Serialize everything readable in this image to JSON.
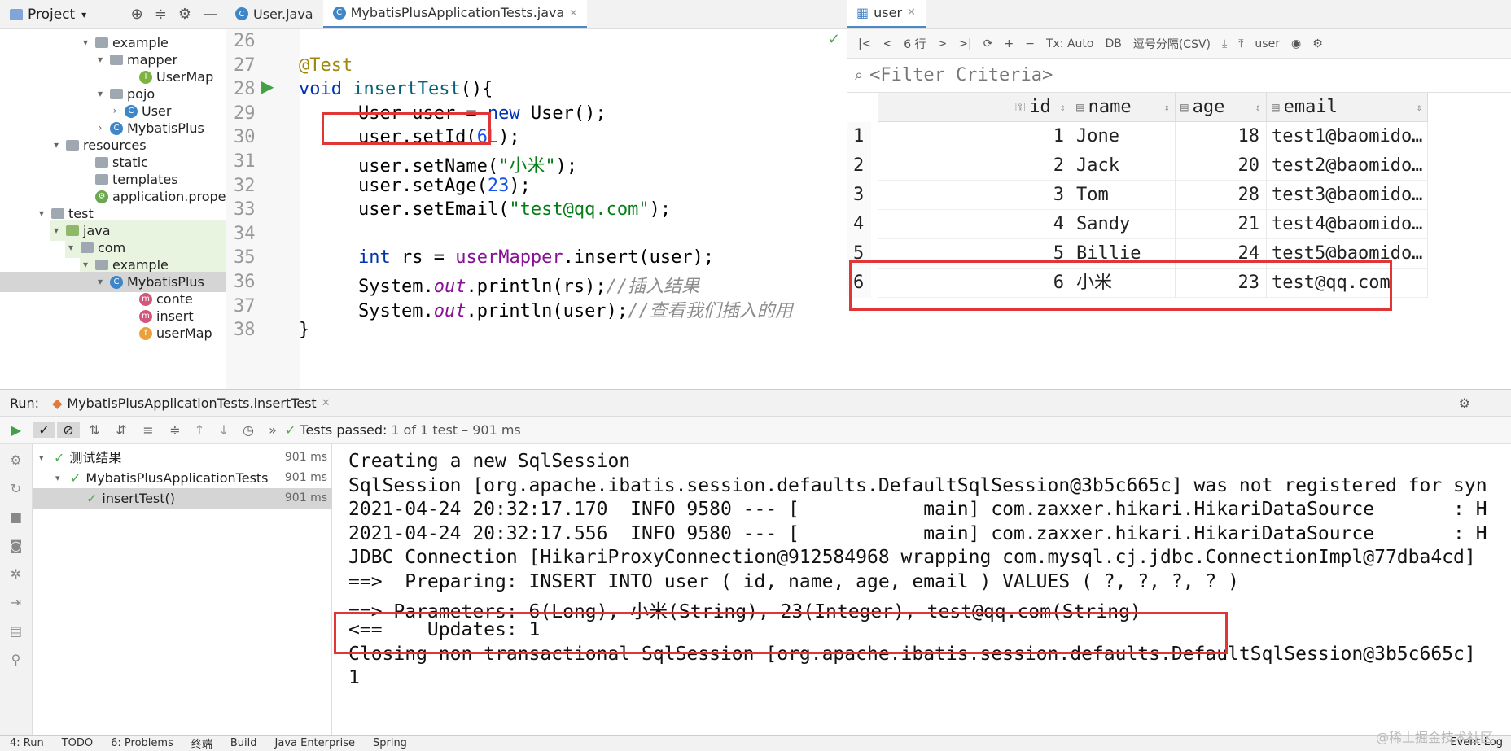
{
  "project": {
    "title": "Project",
    "tree": [
      {
        "label": "example",
        "level": 6,
        "type": "folder",
        "arrow": "▾"
      },
      {
        "label": "mapper",
        "level": 7,
        "type": "folder",
        "arrow": "▾"
      },
      {
        "label": "UserMap",
        "level": 9,
        "type": "interface",
        "arrow": ""
      },
      {
        "label": "pojo",
        "level": 7,
        "type": "folder",
        "arrow": "▾"
      },
      {
        "label": "User",
        "level": 8,
        "type": "class",
        "arrow": "›"
      },
      {
        "label": "MybatisPlus",
        "level": 7,
        "type": "class",
        "arrow": "›"
      },
      {
        "label": "resources",
        "level": 4,
        "type": "folder",
        "arrow": "▾"
      },
      {
        "label": "static",
        "level": 6,
        "type": "folder",
        "arrow": ""
      },
      {
        "label": "templates",
        "level": 6,
        "type": "folder",
        "arrow": ""
      },
      {
        "label": "application.prope",
        "level": 6,
        "type": "props",
        "arrow": ""
      },
      {
        "label": "test",
        "level": 3,
        "type": "folder",
        "arrow": "▾"
      },
      {
        "label": "java",
        "level": 4,
        "type": "srcfolder",
        "arrow": "▾"
      },
      {
        "label": "com",
        "level": 5,
        "type": "folder",
        "arrow": "▾"
      },
      {
        "label": "example",
        "level": 6,
        "type": "folder",
        "arrow": "▾"
      },
      {
        "label": "MybatisPlus",
        "level": 7,
        "type": "class",
        "arrow": "▾"
      },
      {
        "label": "conte",
        "level": 9,
        "type": "method",
        "arrow": ""
      },
      {
        "label": "insert",
        "level": 9,
        "type": "method",
        "arrow": ""
      },
      {
        "label": "userMap",
        "level": 9,
        "type": "field",
        "arrow": ""
      }
    ]
  },
  "editor": {
    "tabs": [
      {
        "label": "User.java",
        "active": false
      },
      {
        "label": "MybatisPlusApplicationTests.java",
        "active": true
      }
    ],
    "lines": [
      {
        "n": "26",
        "html": ""
      },
      {
        "n": "27",
        "html": "<span class='ann'>@Test</span>"
      },
      {
        "n": "28",
        "html": "<span class='kw'>void</span> <span class='fn'>insertTest</span>(){"
      },
      {
        "n": "29",
        "html": "    User user = <span class='kw'>new</span> User();"
      },
      {
        "n": "30",
        "html": "    user.setId(<span class='num'>6L</span>);"
      },
      {
        "n": "31",
        "html": "    user.setName(<span class='str'>\"小米\"</span>);"
      },
      {
        "n": "32",
        "html": "    user.setAge(<span class='num'>23</span>);"
      },
      {
        "n": "33",
        "html": "    user.setEmail(<span class='str'>\"test@qq.com\"</span>);"
      },
      {
        "n": "34",
        "html": ""
      },
      {
        "n": "35",
        "html": "    <span class='kw'>int</span> rs = <span class='fld'>userMapper</span>.insert(user);"
      },
      {
        "n": "36",
        "html": "    System.<span class='stat'>out</span>.println(rs);<span class='cmt'>//插入结果</span>"
      },
      {
        "n": "37",
        "html": "    System.<span class='stat'>out</span>.println(user);<span class='cmt'>//查看我们插入的用</span>"
      },
      {
        "n": "38",
        "html": "}"
      }
    ]
  },
  "db": {
    "tab": "user",
    "rows_label": "6 行",
    "tx_label": "Tx: Auto",
    "format_label": "逗号分隔(CSV)",
    "schema_label": "user",
    "filter_placeholder": "<Filter Criteria>",
    "columns": [
      "id",
      "name",
      "age",
      "email"
    ],
    "rows": [
      [
        "1",
        "1",
        "Jone",
        "18",
        "test1@baomido…"
      ],
      [
        "2",
        "2",
        "Jack",
        "20",
        "test2@baomido…"
      ],
      [
        "3",
        "3",
        "Tom",
        "28",
        "test3@baomido…"
      ],
      [
        "4",
        "4",
        "Sandy",
        "21",
        "test4@baomido…"
      ],
      [
        "5",
        "5",
        "Billie",
        "24",
        "test5@baomido…"
      ],
      [
        "6",
        "6",
        "小米",
        "23",
        "test@qq.com"
      ]
    ]
  },
  "run": {
    "label": "Run:",
    "config": "MybatisPlusApplicationTests.insertTest",
    "status_prefix": "Tests passed:",
    "status_count": "1",
    "status_suffix": "of 1 test – 901 ms",
    "tree": [
      {
        "label": "测试结果",
        "ms": "901 ms",
        "indent": 0
      },
      {
        "label": "MybatisPlusApplicationTests",
        "ms": "901 ms",
        "indent": 1
      },
      {
        "label": "insertTest()",
        "ms": "901 ms",
        "indent": 2
      }
    ],
    "console": [
      "Creating a new SqlSession",
      "SqlSession [org.apache.ibatis.session.defaults.DefaultSqlSession@3b5c665c] was not registered for syn",
      "2021-04-24 20:32:17.170  INFO 9580 --- [           main] com.zaxxer.hikari.HikariDataSource       : H",
      "2021-04-24 20:32:17.556  INFO 9580 --- [           main] com.zaxxer.hikari.HikariDataSource       : H",
      "JDBC Connection [HikariProxyConnection@912584968 wrapping com.mysql.cj.jdbc.ConnectionImpl@77dba4cd]",
      "==>  Preparing: INSERT INTO user ( id, name, age, email ) VALUES ( ?, ?, ?, ? )",
      "==> Parameters: 6(Long), 小米(String), 23(Integer), test@qq.com(String)",
      "<==    Updates: 1",
      "Closing non transactional SqlSession [org.apache.ibatis.session.defaults.DefaultSqlSession@3b5c665c]",
      "1"
    ]
  },
  "bottom": [
    "4: Run",
    "TODO",
    "6: Problems",
    "终端",
    "Build",
    "Java Enterprise",
    "Spring"
  ],
  "event_log": "Event Log",
  "watermark": "@稀土掘金技术社区"
}
